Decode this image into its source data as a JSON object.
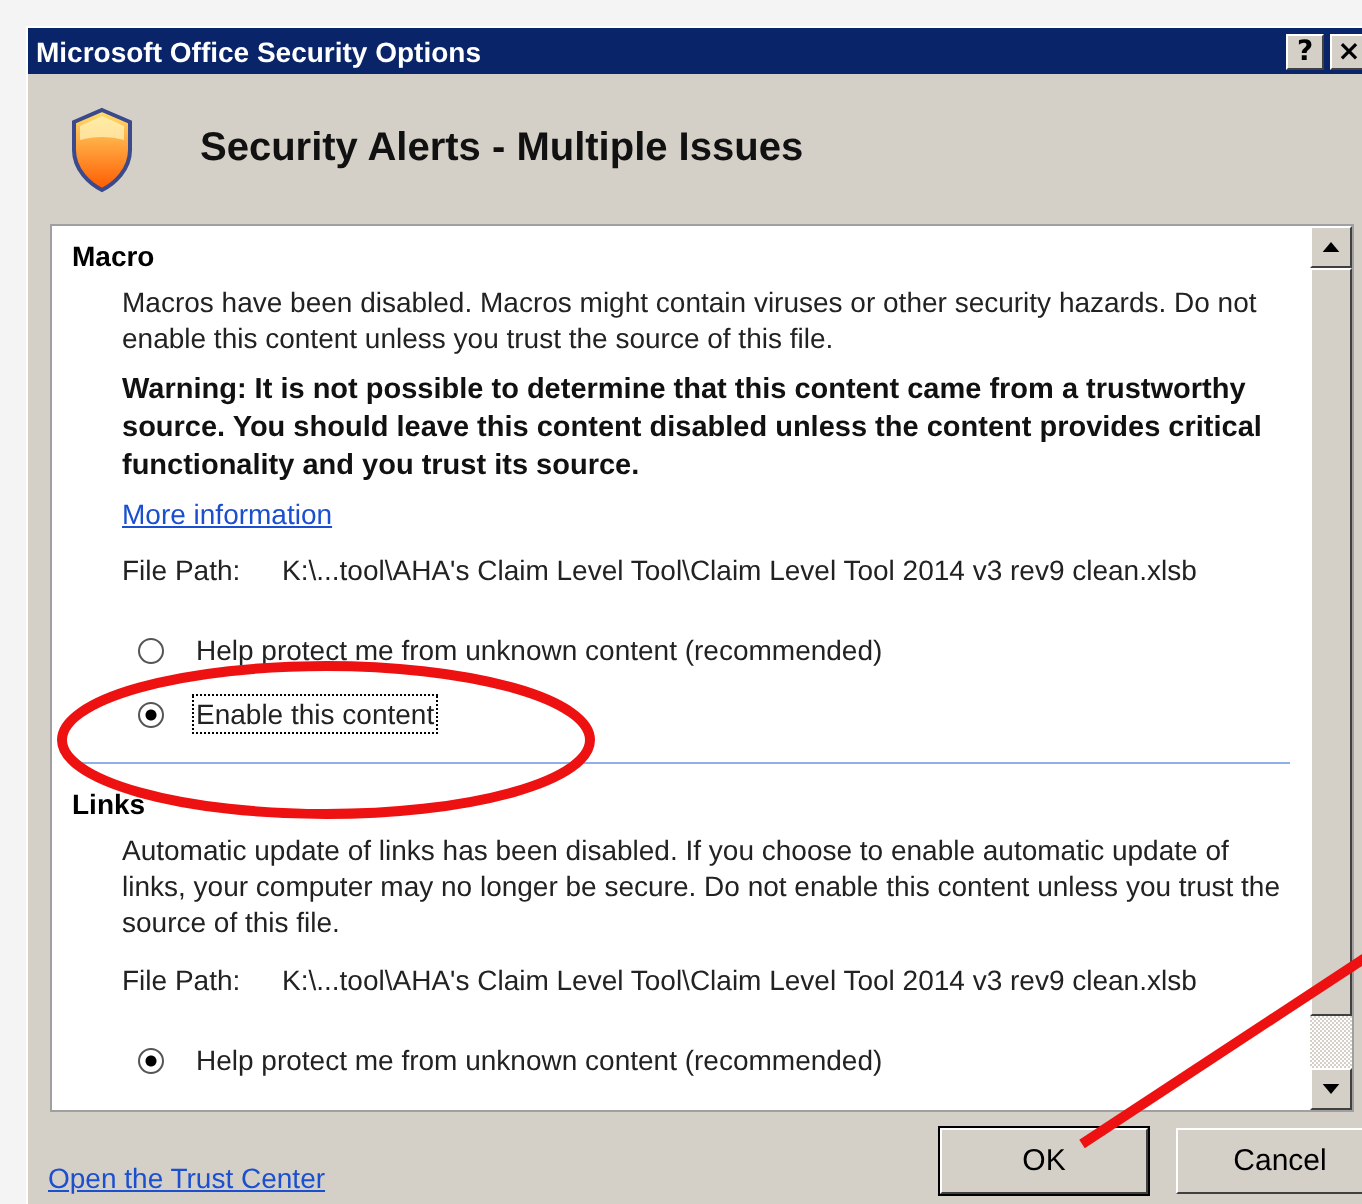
{
  "window": {
    "title": "Microsoft Office Security Options",
    "help_button": "?",
    "close_button": "×"
  },
  "header": {
    "title": "Security Alerts - Multiple Issues"
  },
  "sections": [
    {
      "heading": "Macro",
      "description": "Macros have been disabled. Macros might contain viruses or other security hazards. Do not enable this content unless you trust the source of this file.",
      "warning": "Warning: It is not possible to determine that this content came from a trustworthy source. You should leave this content disabled unless the content provides critical functionality and you trust its source.",
      "link": "More information",
      "file_path_label": "File Path:",
      "file_path": "K:\\...tool\\AHA's Claim Level Tool\\Claim Level Tool 2014 v3 rev9 clean.xlsb",
      "options": [
        {
          "label": "Help protect me from unknown content (recommended)",
          "selected": false,
          "focused": false
        },
        {
          "label": "Enable this content",
          "selected": true,
          "focused": true
        }
      ]
    },
    {
      "heading": "Links",
      "description": "Automatic update of links has been disabled. If you choose to enable automatic update of links, your computer may no longer be secure. Do not enable this content unless you trust the source of this file.",
      "file_path_label": "File Path:",
      "file_path": "K:\\...tool\\AHA's Claim Level Tool\\Claim Level Tool 2014 v3 rev9 clean.xlsb",
      "options": [
        {
          "label": "Help protect me from unknown content (recommended)",
          "selected": true,
          "focused": false
        }
      ]
    }
  ],
  "footer": {
    "link": "Open the Trust Center",
    "buttons": [
      {
        "label": "OK",
        "default": true
      },
      {
        "label": "Cancel",
        "default": false
      }
    ]
  }
}
